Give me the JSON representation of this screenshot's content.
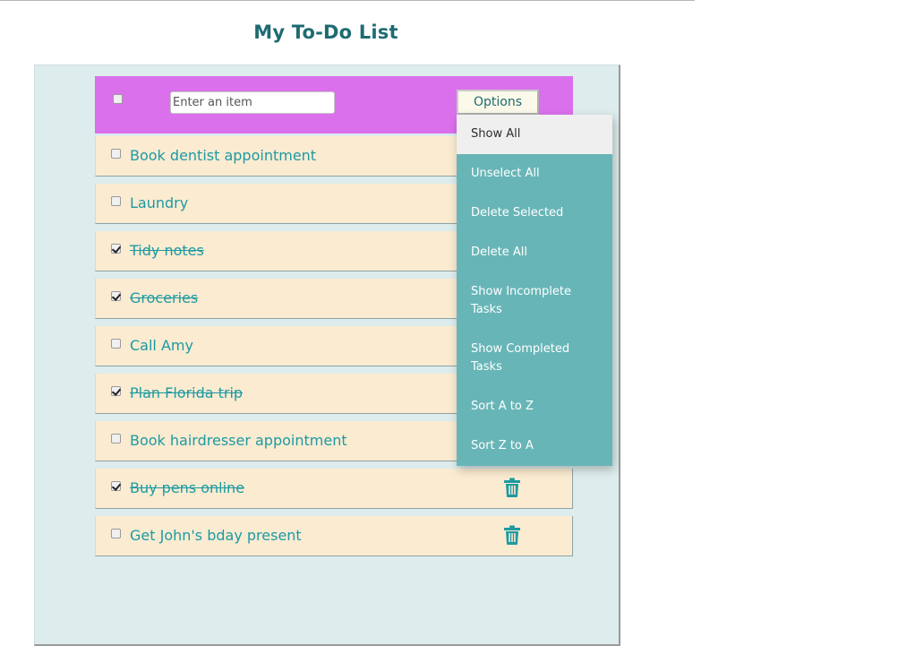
{
  "page": {
    "title": "My To-Do List"
  },
  "header": {
    "input_placeholder": "Enter an item",
    "options_label": "Options"
  },
  "todos": [
    {
      "text": "Book dentist appointment",
      "done": false
    },
    {
      "text": "Laundry",
      "done": false
    },
    {
      "text": "Tidy notes",
      "done": true
    },
    {
      "text": "Groceries",
      "done": true
    },
    {
      "text": "Call Amy",
      "done": false
    },
    {
      "text": "Plan Florida trip",
      "done": true
    },
    {
      "text": "Book hairdresser appointment",
      "done": false
    },
    {
      "text": "Buy pens online",
      "done": true
    },
    {
      "text": "Get John's bday present",
      "done": false
    }
  ],
  "options_menu": {
    "items": [
      {
        "label": "Show All",
        "active": true
      },
      {
        "label": "Unselect All",
        "active": false
      },
      {
        "label": "Delete Selected",
        "active": false
      },
      {
        "label": "Delete All",
        "active": false
      },
      {
        "label": "Show Incomplete Tasks",
        "active": false
      },
      {
        "label": "Show Completed Tasks",
        "active": false
      },
      {
        "label": "Sort A to Z",
        "active": false
      },
      {
        "label": "Sort Z to A",
        "active": false
      }
    ]
  },
  "icons": {
    "row_delete": "trash-icon"
  },
  "colors": {
    "title": "#1e6b72",
    "header_bar": "#db70ec",
    "board_background": "#ddecec",
    "row_background": "#faebd1",
    "task_text": "#1d9aa2",
    "menu_background": "#68b5b7",
    "menu_active": "#efefef",
    "trash": "#1d9aa2"
  }
}
